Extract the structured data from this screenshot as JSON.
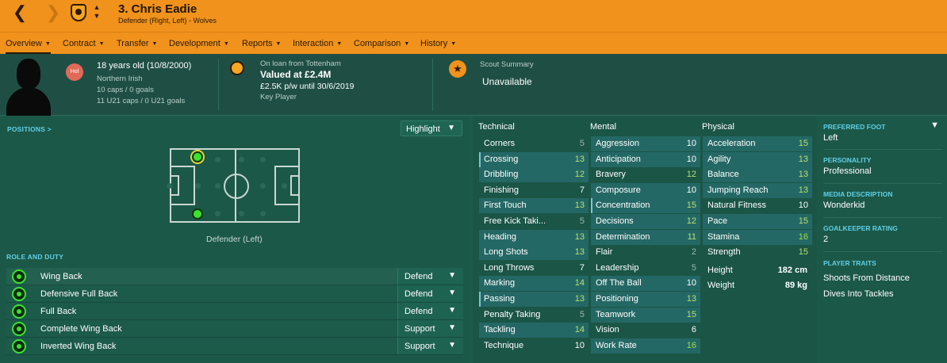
{
  "header": {
    "name": "3. Chris Eadie",
    "subtitle": "Defender (Right, Left) - Wolves",
    "back_glyph": "❮",
    "forward_glyph": "❯",
    "updown_glyph": "▲▼",
    "crest_icon": "wolves-crest-icon"
  },
  "menu": [
    {
      "label": "Overview",
      "active": true
    },
    {
      "label": "Contract"
    },
    {
      "label": "Transfer"
    },
    {
      "label": "Development"
    },
    {
      "label": "Reports"
    },
    {
      "label": "Interaction"
    },
    {
      "label": "Comparison"
    },
    {
      "label": "History"
    }
  ],
  "info": {
    "badge": "Hol",
    "age": "18 years old (10/8/2000)",
    "nationality": "Northern Irish",
    "caps": "10 caps / 0 goals",
    "u21_caps": "11 U21 caps / 0 U21 goals",
    "loan": "On loan from Tottenham",
    "valued": "Valued at £2.4M",
    "wage": "£2.5K p/w until 30/6/2019",
    "status": "Key Player",
    "scout_title": "Scout Summary",
    "scout_value": "Unavailable",
    "star_glyph": "★"
  },
  "positions": {
    "label": "POSITIONS >",
    "highlight": "Highlight",
    "caption": "Defender (Left)"
  },
  "role_duty": {
    "label": "ROLE AND DUTY",
    "rows": [
      {
        "role": "Wing Back",
        "duty": "Defend"
      },
      {
        "role": "Defensive Full Back",
        "duty": "Defend"
      },
      {
        "role": "Full Back",
        "duty": "Defend"
      },
      {
        "role": "Complete Wing Back",
        "duty": "Support"
      },
      {
        "role": "Inverted Wing Back",
        "duty": "Support"
      }
    ]
  },
  "attributes": {
    "technical_label": "Technical",
    "mental_label": "Mental",
    "physical_label": "Physical",
    "technical": [
      {
        "name": "Corners",
        "value": "5"
      },
      {
        "name": "Crossing",
        "value": "13"
      },
      {
        "name": "Dribbling",
        "value": "12"
      },
      {
        "name": "Finishing",
        "value": "7"
      },
      {
        "name": "First Touch",
        "value": "13"
      },
      {
        "name": "Free Kick Taki...",
        "value": "5"
      },
      {
        "name": "Heading",
        "value": "13"
      },
      {
        "name": "Long Shots",
        "value": "13"
      },
      {
        "name": "Long Throws",
        "value": "7"
      },
      {
        "name": "Marking",
        "value": "14"
      },
      {
        "name": "Passing",
        "value": "13"
      },
      {
        "name": "Penalty Taking",
        "value": "5"
      },
      {
        "name": "Tackling",
        "value": "14"
      },
      {
        "name": "Technique",
        "value": "10"
      }
    ],
    "mental": [
      {
        "name": "Aggression",
        "value": "10"
      },
      {
        "name": "Anticipation",
        "value": "10"
      },
      {
        "name": "Bravery",
        "value": "12"
      },
      {
        "name": "Composure",
        "value": "10"
      },
      {
        "name": "Concentration",
        "value": "15"
      },
      {
        "name": "Decisions",
        "value": "12"
      },
      {
        "name": "Determination",
        "value": "11"
      },
      {
        "name": "Flair",
        "value": "2"
      },
      {
        "name": "Leadership",
        "value": "5"
      },
      {
        "name": "Off The Ball",
        "value": "10"
      },
      {
        "name": "Positioning",
        "value": "13"
      },
      {
        "name": "Teamwork",
        "value": "15"
      },
      {
        "name": "Vision",
        "value": "6"
      },
      {
        "name": "Work Rate",
        "value": "16"
      }
    ],
    "physical": [
      {
        "name": "Acceleration",
        "value": "15"
      },
      {
        "name": "Agility",
        "value": "13"
      },
      {
        "name": "Balance",
        "value": "13"
      },
      {
        "name": "Jumping Reach",
        "value": "13"
      },
      {
        "name": "Natural Fitness",
        "value": "10"
      },
      {
        "name": "Pace",
        "value": "15"
      },
      {
        "name": "Stamina",
        "value": "16"
      },
      {
        "name": "Strength",
        "value": "15"
      }
    ],
    "height_label": "Height",
    "height": "182 cm",
    "weight_label": "Weight",
    "weight": "89 kg"
  },
  "side": {
    "foot_label": "PREFERRED FOOT",
    "foot": "Left",
    "personality_label": "PERSONALITY",
    "personality": "Professional",
    "media_label": "MEDIA DESCRIPTION",
    "media": "Wonderkid",
    "gk_label": "GOALKEEPER RATING",
    "gk": "2",
    "traits_label": "PLAYER TRAITS",
    "traits": [
      "Shoots From Distance",
      "Dives Into Tackles"
    ]
  },
  "colors": {
    "header_orange": "#f0921c",
    "panel_green": "#1c5848",
    "accent_cyan": "#5fd0e8",
    "position_green": "#3de12f"
  }
}
